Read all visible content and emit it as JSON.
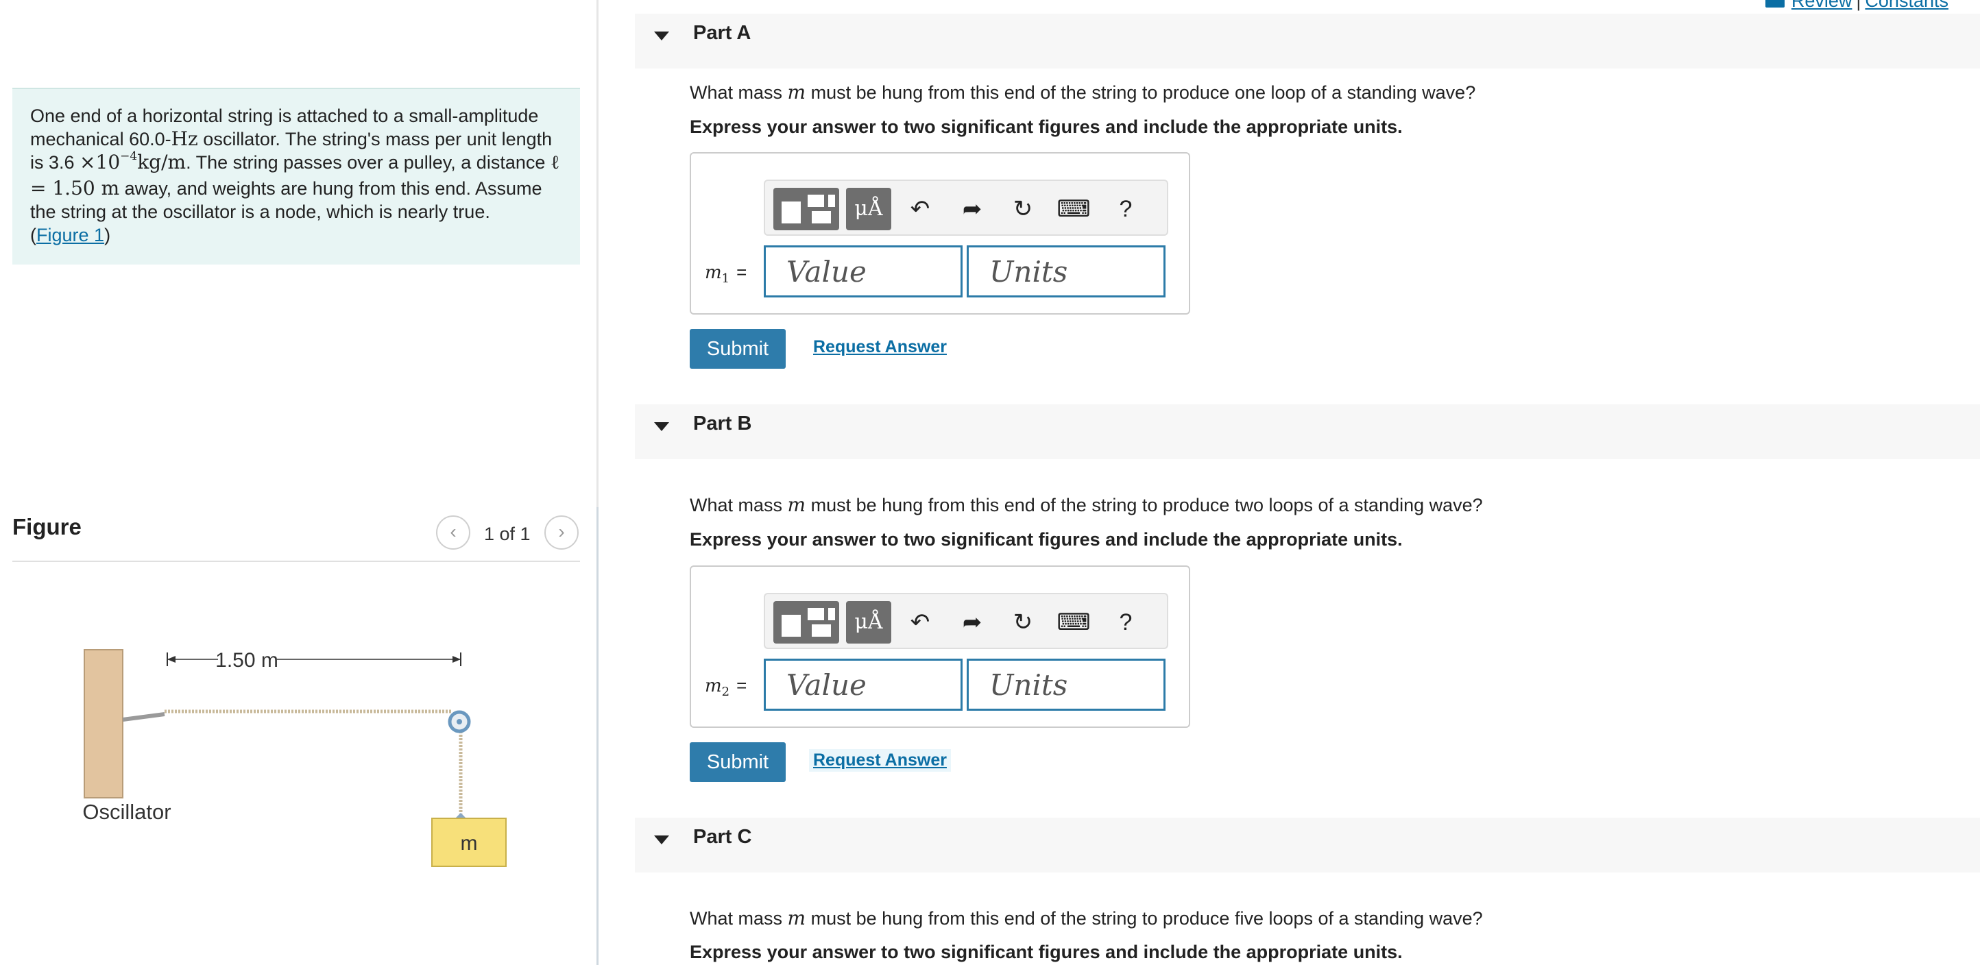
{
  "problem": {
    "t1": "One end of a horizontal string is attached to a small-amplitude mechanical 60.0-",
    "hz": "Hz",
    "t2": " oscillator. The string's mass per unit length is 3.6 ",
    "times": "×10",
    "exp": "−4",
    "unit": "kg/m",
    "t3": ". The string passes over a pulley, a distance ",
    "ell": "ℓ = 1.50 m",
    "t4": " away, and weights are hung from this end. Assume the string at the oscillator is a node, which is nearly true.",
    "fig_open": "(",
    "fig_link": "Figure 1",
    "fig_close": ")"
  },
  "figure": {
    "title": "Figure",
    "counter": "1 of 1",
    "prev_icon": "chevron-left-icon",
    "next_icon": "chevron-right-icon",
    "distance_label": "1.50 m",
    "oscillator_label": "Oscillator",
    "mass_label": "m"
  },
  "top_links": {
    "review": "Review",
    "separator": "|",
    "constants": "Constants"
  },
  "parts": [
    {
      "title": "Part A",
      "question_pre": "What mass ",
      "var": "m",
      "question_post": " must be hung from this end of the string to produce one loop of a standing wave?",
      "instruction": "Express your answer to two significant figures and include the appropriate units.",
      "answer_var": "m",
      "answer_sub": "1",
      "equals": "=",
      "value_placeholder": "Value",
      "units_placeholder": "Units",
      "submit": "Submit",
      "request": "Request Answer"
    },
    {
      "title": "Part B",
      "question_pre": "What mass ",
      "var": "m",
      "question_post": " must be hung from this end of the string to produce two loops of a standing wave?",
      "instruction": "Express your answer to two significant figures and include the appropriate units.",
      "answer_var": "m",
      "answer_sub": "2",
      "equals": "=",
      "value_placeholder": "Value",
      "units_placeholder": "Units",
      "submit": "Submit",
      "request": "Request Answer"
    },
    {
      "title": "Part C",
      "question_pre": "What mass ",
      "var": "m",
      "question_post": " must be hung from this end of the string to produce five loops of a standing wave?",
      "instruction": "Express your answer to two significant figures and include the appropriate units."
    }
  ],
  "toolbar": {
    "templates_icon": "templates-icon",
    "units_label": "μÅ",
    "undo_icon": "undo-icon",
    "redo_icon": "redo-icon",
    "reset_icon": "reset-icon",
    "keyboard_icon": "keyboard-icon",
    "help_label": "?"
  },
  "colors": {
    "problem_bg": "#e8f5f4",
    "accent": "#2e7cab",
    "link": "#0b6ea4",
    "part_header_bg": "#f7f7f7",
    "wall": "#e2c49f",
    "weight": "#f7e07a"
  }
}
